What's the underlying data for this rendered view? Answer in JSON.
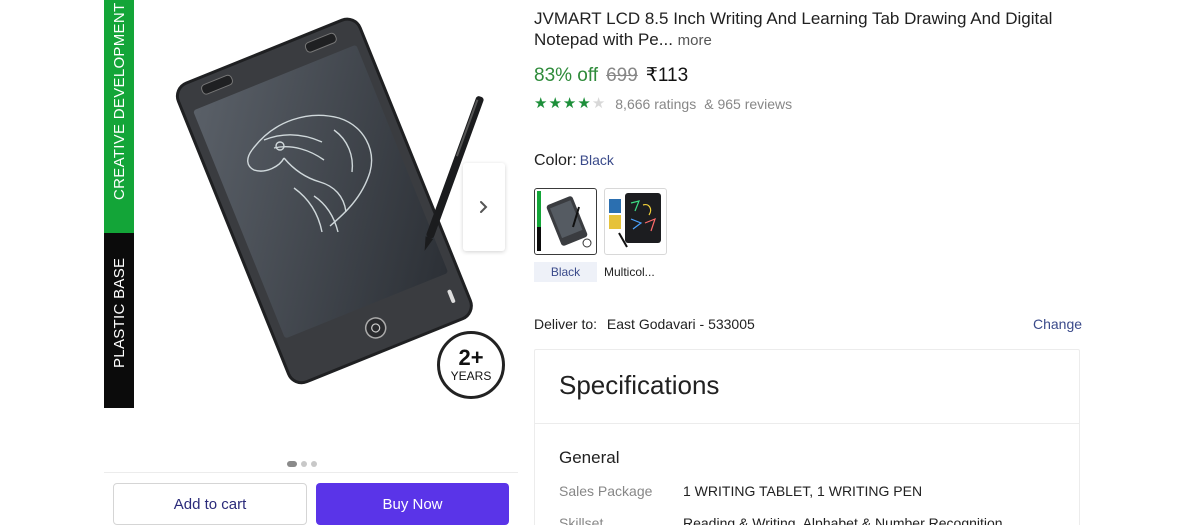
{
  "product": {
    "title": "JVMART LCD 8.5 Inch Writing And Learning Tab Drawing And Digital Notepad with Pe...",
    "more_label": "more",
    "discount": "83% off",
    "mrp": "699",
    "price": "₹113",
    "rating": 4,
    "rating_max": 5,
    "ratings_text": "8,666 ratings",
    "reviews_text": "& 965 reviews"
  },
  "gallery": {
    "banner_top": "CREATIVE DEVELOPMENT",
    "banner_bottom": "PLASTIC BASE",
    "badge_number": "2+",
    "badge_label": "YEARS",
    "next_icon": "chevron-right-icon",
    "slide_count": 3,
    "active_slide": 1
  },
  "color": {
    "label": "Color:",
    "selected": "Black",
    "options": [
      {
        "label": "Black"
      },
      {
        "label": "Multicol..."
      }
    ]
  },
  "delivery": {
    "label": "Deliver to:",
    "location": "East Godavari - 533005",
    "change_label": "Change"
  },
  "specifications": {
    "heading": "Specifications",
    "group": "General",
    "rows": [
      {
        "key": "Sales Package",
        "value": "1 WRITING TABLET, 1 WRITING PEN"
      },
      {
        "key": "Skillset",
        "value": "Reading & Writing, Alphabet & Number Recognition"
      }
    ]
  },
  "actions": {
    "add_to_cart": "Add to cart",
    "buy_now": "Buy Now"
  },
  "colors": {
    "accent": "#5a34e8",
    "discount_green": "#2e8b3a",
    "star_green": "#1d8f3a",
    "banner_green": "#13a538"
  }
}
